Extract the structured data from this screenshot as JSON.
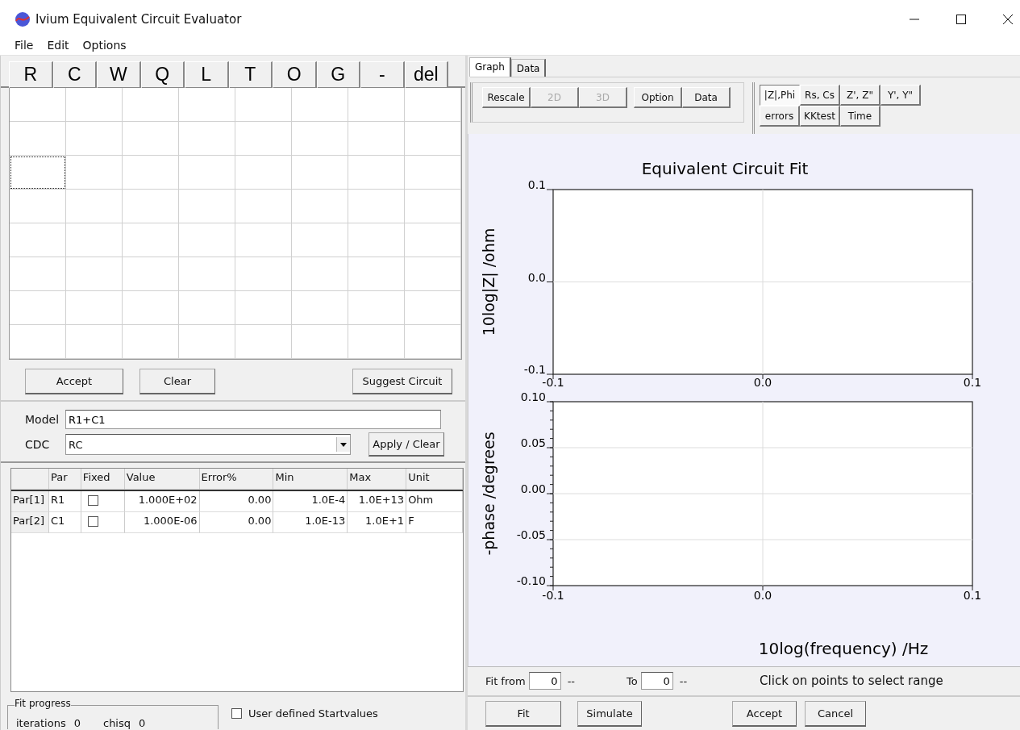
{
  "window": {
    "title": "Ivium Equivalent  Circuit Evaluator"
  },
  "menu": [
    "File",
    "Edit",
    "Options"
  ],
  "element_buttons": [
    "R",
    "C",
    "W",
    "Q",
    "L",
    "T",
    "O",
    "G",
    "-",
    "del"
  ],
  "circuit_grid": [
    {
      "cells": [
        {
          "selected": false
        },
        {
          "selected": false
        },
        {
          "selected": false
        },
        {
          "selected": false
        },
        {
          "selected": false
        },
        {
          "selected": false
        },
        {
          "selected": false
        },
        {
          "selected": false
        }
      ]
    },
    {
      "cells": [
        {
          "selected": false
        },
        {
          "selected": false
        },
        {
          "selected": false
        },
        {
          "selected": false
        },
        {
          "selected": false
        },
        {
          "selected": false
        },
        {
          "selected": false
        },
        {
          "selected": false
        }
      ]
    },
    {
      "cells": [
        {
          "selected": true
        },
        {
          "selected": false
        },
        {
          "selected": false
        },
        {
          "selected": false
        },
        {
          "selected": false
        },
        {
          "selected": false
        },
        {
          "selected": false
        },
        {
          "selected": false
        }
      ]
    },
    {
      "cells": [
        {
          "selected": false
        },
        {
          "selected": false
        },
        {
          "selected": false
        },
        {
          "selected": false
        },
        {
          "selected": false
        },
        {
          "selected": false
        },
        {
          "selected": false
        },
        {
          "selected": false
        }
      ]
    },
    {
      "cells": [
        {
          "selected": false
        },
        {
          "selected": false
        },
        {
          "selected": false
        },
        {
          "selected": false
        },
        {
          "selected": false
        },
        {
          "selected": false
        },
        {
          "selected": false
        },
        {
          "selected": false
        }
      ]
    },
    {
      "cells": [
        {
          "selected": false
        },
        {
          "selected": false
        },
        {
          "selected": false
        },
        {
          "selected": false
        },
        {
          "selected": false
        },
        {
          "selected": false
        },
        {
          "selected": false
        },
        {
          "selected": false
        }
      ]
    },
    {
      "cells": [
        {
          "selected": false
        },
        {
          "selected": false
        },
        {
          "selected": false
        },
        {
          "selected": false
        },
        {
          "selected": false
        },
        {
          "selected": false
        },
        {
          "selected": false
        },
        {
          "selected": false
        }
      ]
    },
    {
      "cells": [
        {
          "selected": false
        },
        {
          "selected": false
        },
        {
          "selected": false
        },
        {
          "selected": false
        },
        {
          "selected": false
        },
        {
          "selected": false
        },
        {
          "selected": false
        },
        {
          "selected": false
        }
      ]
    }
  ],
  "circuit_buttons": {
    "accept": "Accept",
    "clear": "Clear",
    "suggest": "Suggest Circuit"
  },
  "model": {
    "label": "Model",
    "value": "R1+C1"
  },
  "cdc": {
    "label": "CDC",
    "value": "RC",
    "button": "Apply / Clear"
  },
  "parameters": {
    "columns": [
      "Par",
      "Fixed",
      "Value",
      "Error%",
      "Min",
      "Max",
      "Unit"
    ],
    "rows": [
      {
        "label": "Par[1]",
        "par": "R1",
        "fixed": false,
        "value": "1.000E+02",
        "error": "0.00",
        "min": "1.0E-4",
        "max": "1.0E+13",
        "unit": "Ohm"
      },
      {
        "label": "Par[2]",
        "par": "C1",
        "fixed": false,
        "value": "1.000E-06",
        "error": "0.00",
        "min": "1.0E-13",
        "max": "1.0E+1",
        "unit": "F"
      }
    ]
  },
  "fit_progress": {
    "title": "Fit progress",
    "iterations_label": "iterations",
    "iterations": "0",
    "chisq_label": "chisq",
    "chisq": "0"
  },
  "user_defined_startvalues": {
    "label": "User defined Startvalues",
    "checked": false
  },
  "tabs": [
    {
      "label": "Graph",
      "selected": true
    },
    {
      "label": "Data",
      "selected": false
    }
  ],
  "graph_toolbar": [
    {
      "label": "Rescale",
      "disabled": false
    },
    {
      "label": "2D",
      "disabled": true
    },
    {
      "label": "3D",
      "disabled": true
    },
    {
      "label": "Option",
      "disabled": false
    },
    {
      "label": "Data",
      "disabled": false
    }
  ],
  "plot_modes": [
    [
      {
        "label": "|Z|,Phi",
        "selected": true
      },
      {
        "label": "Rs, Cs",
        "selected": false
      },
      {
        "label": "Z', Z\"",
        "selected": false
      },
      {
        "label": "Y', Y\"",
        "selected": false
      }
    ],
    [
      {
        "label": "errors",
        "selected": false
      },
      {
        "label": "KKtest",
        "selected": false
      },
      {
        "label": "Time",
        "selected": false
      }
    ]
  ],
  "charts": [
    {
      "chart_data": {
        "type": "line",
        "grid": true,
        "title": "Equivalent Circuit Fit",
        "ylabel": "10log|Z| /ohm",
        "xlim": [
          -0.1,
          0.1
        ],
        "ylim": [
          -0.1,
          0.1
        ],
        "xticks": [
          {
            "value": -0.1,
            "label": "-0.1"
          },
          {
            "value": 0,
            "label": "0.0"
          },
          {
            "value": 0.1,
            "label": "0.1"
          }
        ],
        "yticks": [
          {
            "value": 0.1,
            "label": "0.1"
          },
          {
            "value": 0,
            "label": "0.0"
          },
          {
            "value": -0.1,
            "label": "-0.1"
          }
        ]
      }
    },
    {
      "chart_data": {
        "type": "line",
        "grid": true,
        "xlabel": "10log(frequency) /Hz",
        "ylabel": "-phase /degrees",
        "xlim": [
          -0.1,
          0.1
        ],
        "ylim": [
          -0.1,
          0.1
        ],
        "xticks": [
          {
            "value": -0.1,
            "label": "-0.1"
          },
          {
            "value": 0,
            "label": "0.0"
          },
          {
            "value": 0.1,
            "label": "0.1"
          }
        ],
        "yticks": [
          {
            "value": 0.1,
            "label": "0.10"
          },
          {
            "value": 0.05,
            "label": "0.05"
          },
          {
            "value": 0,
            "label": "0.00"
          },
          {
            "value": -0.05,
            "label": "-0.05"
          },
          {
            "value": -0.1,
            "label": "-0.10"
          }
        ]
      }
    }
  ],
  "fit_range": {
    "from_label": "Fit from",
    "from": "0",
    "from_unit": "--",
    "to_label": "To",
    "to": "0",
    "to_unit": "--",
    "hint": "Click on points to select range"
  },
  "bottom_buttons": [
    "Fit",
    "Simulate",
    "Accept",
    "Cancel"
  ]
}
